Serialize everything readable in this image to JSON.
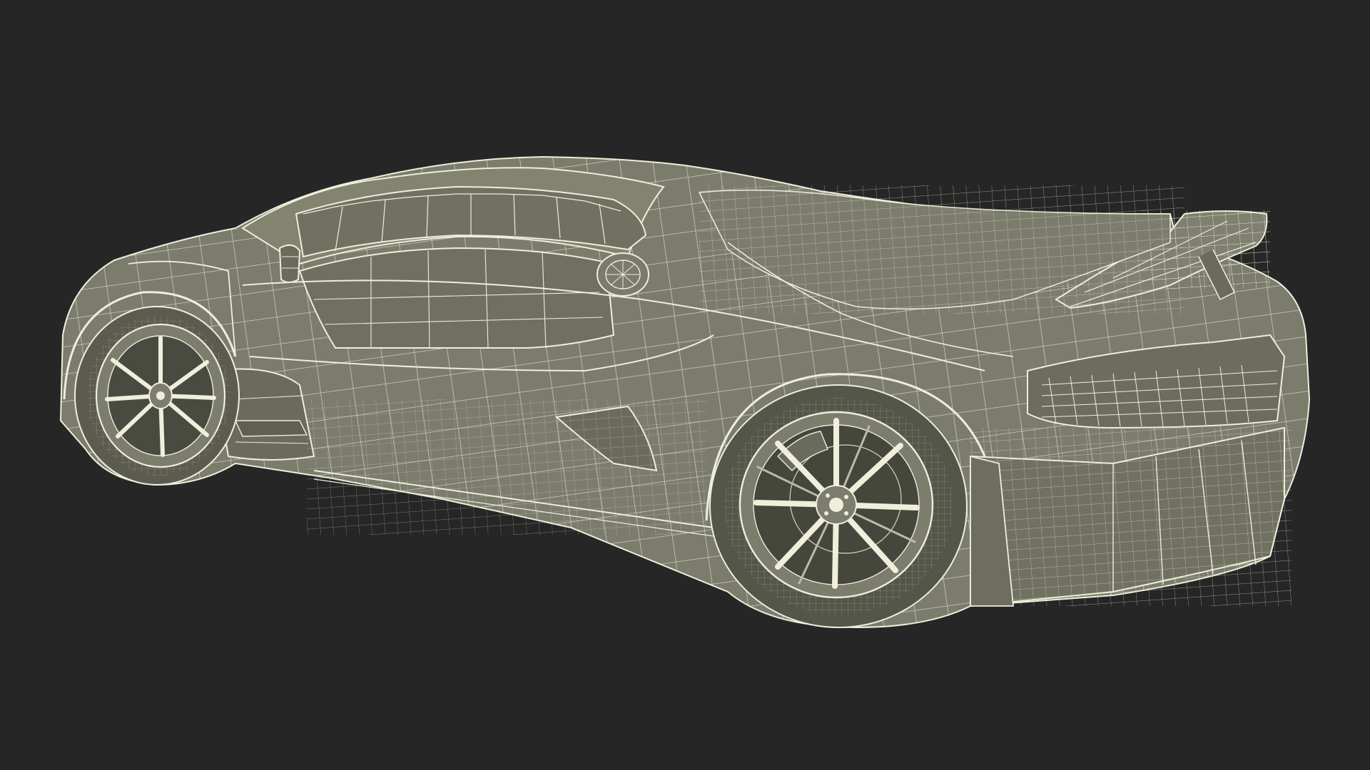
{
  "scene": {
    "subject": "sports-car-wireframe-render",
    "background_color": "#262626",
    "body_fill_color": "#7b7c6c",
    "body_shade_color": "#5e5f52",
    "wire_color": "#eeeedd",
    "wire_dim_color": "#cfd0bd",
    "wheel_inner_color": "#3d3e36"
  }
}
